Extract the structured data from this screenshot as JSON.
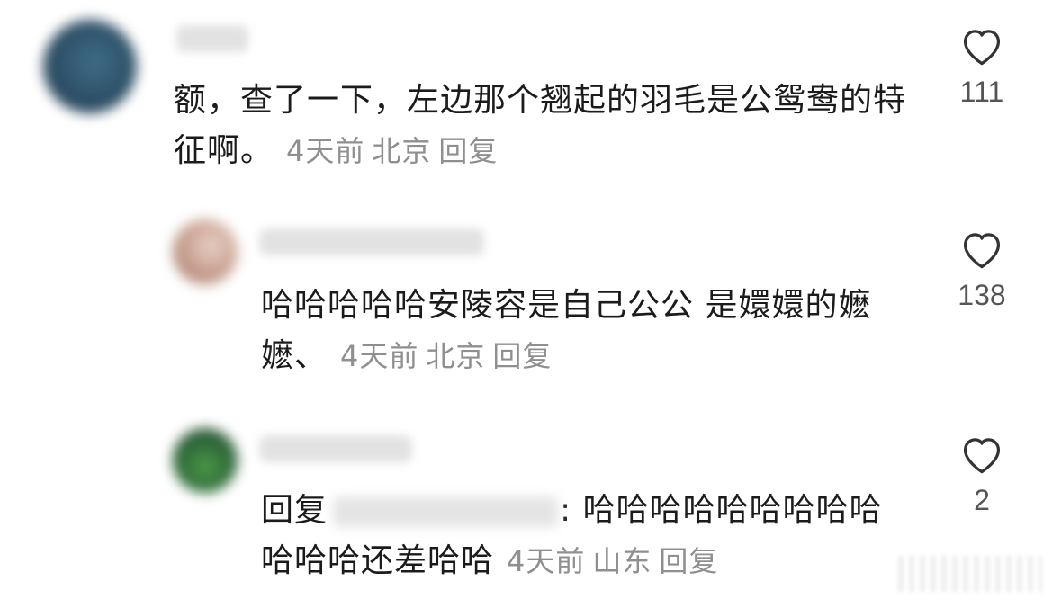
{
  "comments": [
    {
      "text": "额，查了一下，左边那个翘起的羽毛是公鸳鸯的特征啊。",
      "time": "4天前",
      "location": "北京",
      "reply_label": "回复",
      "likes": "111",
      "avatar_color": "#2d4f66"
    },
    {
      "text": "哈哈哈哈哈安陵容是自己公公 是嬛嬛的嬷嬷、",
      "time": "4天前",
      "location": "北京",
      "reply_label": "回复",
      "likes": "138",
      "avatar_color": "#c9a08f"
    },
    {
      "reply_prefix": "回复",
      "text_after_name": ": 哈哈哈哈哈哈哈哈哈哈哈哈还差哈哈",
      "time": "4天前",
      "location": "山东",
      "reply_label": "回复",
      "likes": "2",
      "avatar_color": "#2f6a3a"
    }
  ]
}
